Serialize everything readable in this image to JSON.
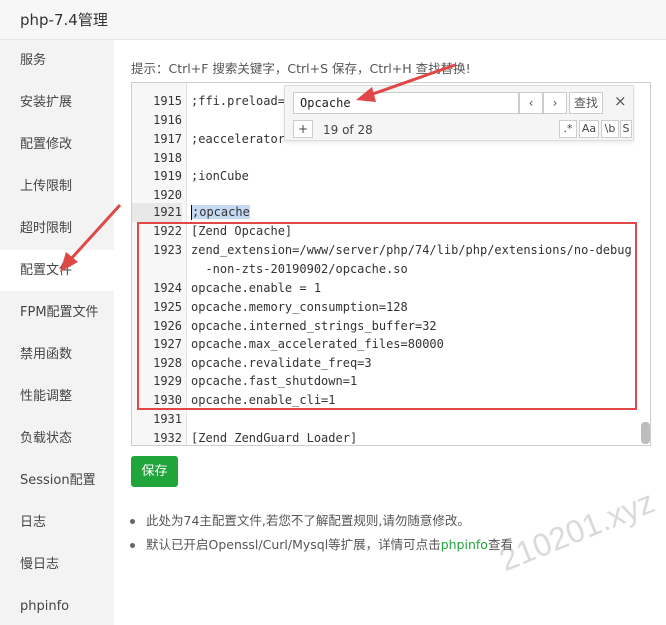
{
  "window": {
    "title": "php-7.4管理"
  },
  "sidebar": {
    "items": [
      {
        "label": "服务"
      },
      {
        "label": "安装扩展"
      },
      {
        "label": "配置修改"
      },
      {
        "label": "上传限制"
      },
      {
        "label": "超时限制"
      },
      {
        "label": "配置文件",
        "active": true
      },
      {
        "label": "FPM配置文件"
      },
      {
        "label": "禁用函数"
      },
      {
        "label": "性能调整"
      },
      {
        "label": "负载状态"
      },
      {
        "label": "Session配置"
      },
      {
        "label": "日志"
      },
      {
        "label": "慢日志"
      },
      {
        "label": "phpinfo"
      }
    ]
  },
  "hint": "提示：Ctrl+F 搜索关键字，Ctrl+S 保存，Ctrl+H 查找替换!",
  "editor": {
    "lines": [
      {
        "num": "1915",
        "code": ";ffi.preload="
      },
      {
        "num": "1916",
        "code": ""
      },
      {
        "num": "1917",
        "code": ";eaccelerator"
      },
      {
        "num": "1918",
        "code": ""
      },
      {
        "num": "1919",
        "code": ";ionCube"
      },
      {
        "num": "1920",
        "code": ""
      },
      {
        "num": "1921",
        "code": ";opcache"
      },
      {
        "num": "1922",
        "code": "[Zend Opcache]"
      },
      {
        "num": "1923",
        "code": "zend_extension=/www/server/php/74/lib/php/extensions/no-debug"
      },
      {
        "num": "",
        "code": "  -non-zts-20190902/opcache.so"
      },
      {
        "num": "1924",
        "code": "opcache.enable = 1"
      },
      {
        "num": "1925",
        "code": "opcache.memory_consumption=128"
      },
      {
        "num": "1926",
        "code": "opcache.interned_strings_buffer=32"
      },
      {
        "num": "1927",
        "code": "opcache.max_accelerated_files=80000"
      },
      {
        "num": "1928",
        "code": "opcache.revalidate_freq=3"
      },
      {
        "num": "1929",
        "code": "opcache.fast_shutdown=1"
      },
      {
        "num": "1930",
        "code": "opcache.enable_cli=1"
      },
      {
        "num": "1931",
        "code": ""
      },
      {
        "num": "1932",
        "code": "[Zend ZendGuard Loader]"
      }
    ],
    "find": {
      "value": "Opcache",
      "find_label": "查找",
      "count": "19 of 28",
      "prev_label": "‹",
      "next_label": "›",
      "close_label": "×",
      "add_label": "+",
      "opt_regex": ".*",
      "opt_case": "Aa",
      "opt_word": "\\b",
      "opt_s": "S"
    }
  },
  "save_label": "保存",
  "notes": [
    {
      "text": "此处为74主配置文件,若您不了解配置规则,请勿随意修改。"
    },
    {
      "text": "默认已开启Openssl/Curl/Mysql等扩展，详情可点击",
      "link": "phpinfo",
      "suffix": "查看"
    }
  ],
  "watermark": "210201.xyz",
  "colors": {
    "accent": "#20a53a",
    "highlight_box": "#e04848",
    "arrow": "#e04848"
  }
}
